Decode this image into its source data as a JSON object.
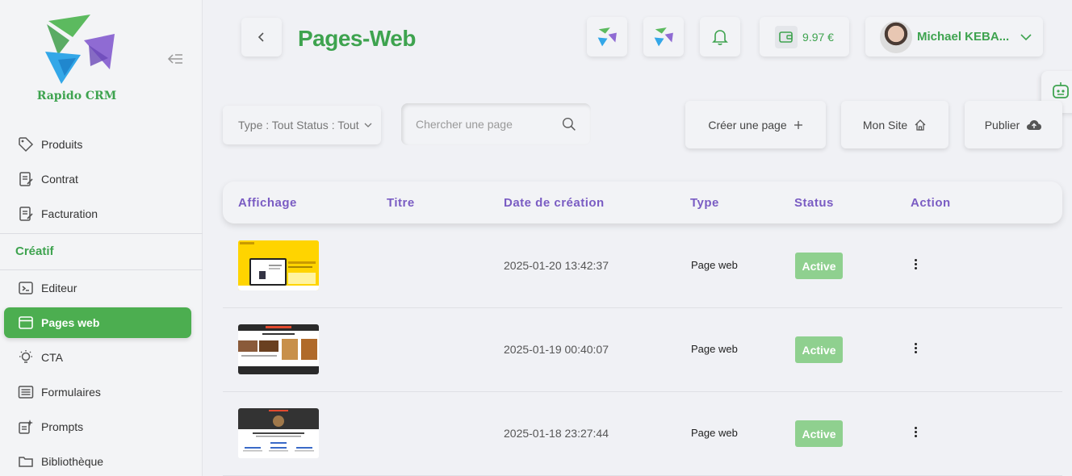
{
  "app": {
    "logo_text": "Rapido CRM"
  },
  "sidebar": {
    "items": [
      {
        "label": "Produits",
        "icon": "tag-icon"
      },
      {
        "label": "Contrat",
        "icon": "contract-icon"
      },
      {
        "label": "Facturation",
        "icon": "invoice-icon"
      }
    ],
    "section": "Créatif",
    "creative_items": [
      {
        "label": "Editeur",
        "icon": "terminal-icon"
      },
      {
        "label": "Pages web",
        "icon": "browser-window-icon",
        "active": true
      },
      {
        "label": "CTA",
        "icon": "lightbulb-icon"
      },
      {
        "label": "Formulaires",
        "icon": "list-form-icon"
      },
      {
        "label": "Prompts",
        "icon": "sparkle-doc-icon"
      },
      {
        "label": "Bibliothèque",
        "icon": "folder-icon"
      }
    ]
  },
  "header": {
    "title": "Pages-Web",
    "wallet_amount": "9.97 €",
    "user_name": "Michael KEBA..."
  },
  "toolbar": {
    "filter_label": "Type : Tout Status : Tout",
    "search_placeholder": "Chercher une page",
    "create_label": "Créer une page",
    "mysite_label": "Mon Site",
    "publish_label": "Publier"
  },
  "table": {
    "headers": [
      "Affichage",
      "Titre",
      "Date de création",
      "Type",
      "Status",
      "Action"
    ],
    "rows": [
      {
        "title": "",
        "date": "2025-01-20 13:42:37",
        "type": "Page web",
        "status": "Active"
      },
      {
        "title": "",
        "date": "2025-01-19 00:40:07",
        "type": "Page web",
        "status": "Active"
      },
      {
        "title": "",
        "date": "2025-01-18 23:27:44",
        "type": "Page web",
        "status": "Active"
      }
    ]
  },
  "colors": {
    "brand_green": "#3ea34f",
    "accent_purple": "#7a5cc3",
    "active_badge": "#8fd08f"
  }
}
